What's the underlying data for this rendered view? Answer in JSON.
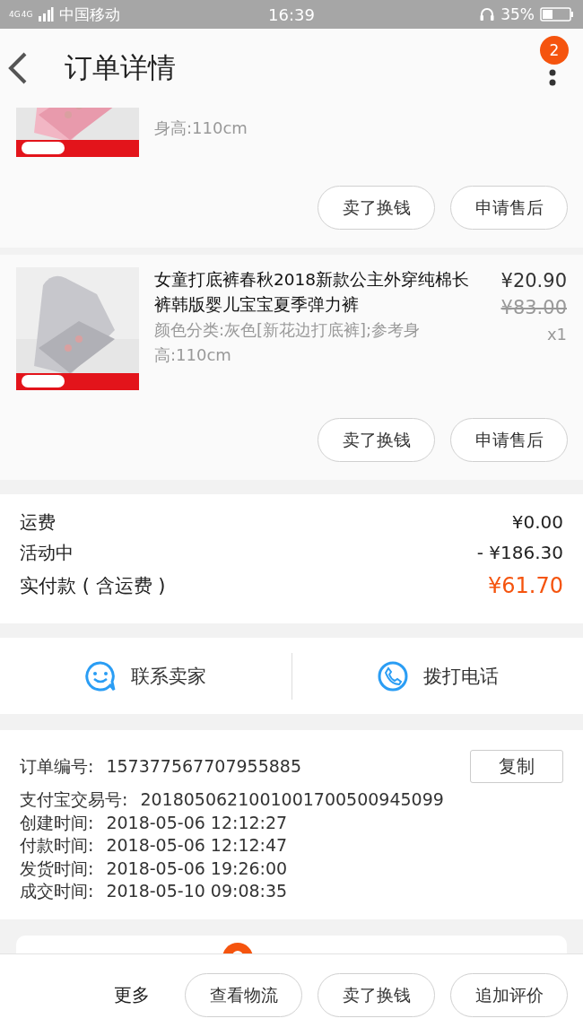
{
  "status_bar": {
    "network": [
      "4G",
      "4G"
    ],
    "carrier": "中国移动",
    "time": "16:39",
    "battery": "35%"
  },
  "header": {
    "title": "订单详情",
    "badge": "2"
  },
  "items": [
    {
      "kind": "partial",
      "attributes": "身高:110cm",
      "buttons": [
        "卖了换钱",
        "申请售后"
      ]
    },
    {
      "kind": "full",
      "title": "女童打底裤春秋2018新款公主外穿纯棉长裤韩版婴儿宝宝夏季弹力裤",
      "price": "¥20.90",
      "original_price": "¥83.00",
      "quantity": "x1",
      "attributes": "颜色分类:灰色[新花边打底裤];参考身高:110cm",
      "buttons": [
        "卖了换钱",
        "申请售后"
      ]
    }
  ],
  "summary": [
    {
      "kind": "normal",
      "label": "运费",
      "value": "¥0.00"
    },
    {
      "kind": "normal",
      "label": "活动中",
      "value": "- ¥186.30"
    },
    {
      "kind": "total",
      "label": "实付款 ( 含运费 )",
      "value": "¥61.70"
    }
  ],
  "contact": [
    {
      "kind": "chat",
      "label": "联系卖家"
    },
    {
      "kind": "phone",
      "label": "拨打电话"
    }
  ],
  "info": {
    "order_number": {
      "label": "订单编号:",
      "value": "157377567707955885"
    },
    "copy_button": "复制",
    "rows": [
      {
        "label": "支付宝交易号:",
        "value": "2018050621001001700500945099"
      },
      {
        "label": "创建时间:",
        "value": "2018-05-06 12:12:27"
      },
      {
        "label": "付款时间:",
        "value": "2018-05-06 12:12:47"
      },
      {
        "label": "发货时间:",
        "value": "2018-05-06 19:26:00"
      },
      {
        "label": "成交时间:",
        "value": "2018-05-10 09:08:35"
      }
    ]
  },
  "bottom_bar": {
    "more": "更多",
    "buttons": [
      "查看物流",
      "卖了换钱",
      "追加评价"
    ]
  }
}
